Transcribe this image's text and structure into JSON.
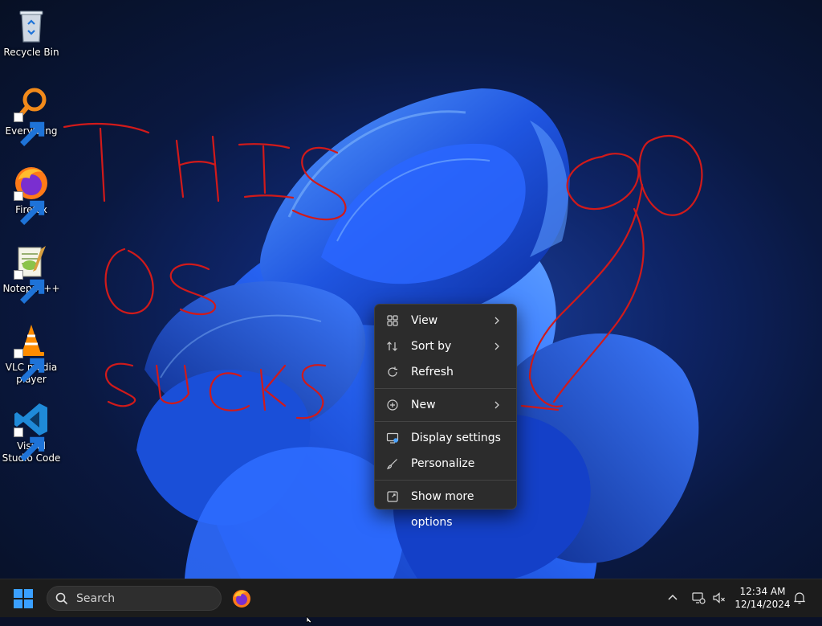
{
  "desktop": {
    "icons": [
      {
        "label": "Recycle Bin",
        "icon": "recycle-bin-icon",
        "shortcut": false
      },
      {
        "label": "Everything",
        "icon": "magnifier-icon",
        "shortcut": true
      },
      {
        "label": "Firefox",
        "icon": "firefox-icon",
        "shortcut": true
      },
      {
        "label": "Notepad++",
        "icon": "notepadpp-icon",
        "shortcut": true
      },
      {
        "label": "VLC media player",
        "icon": "vlc-cone-icon",
        "shortcut": true
      },
      {
        "label": "Visual Studio Code",
        "icon": "vscode-icon",
        "shortcut": true
      }
    ],
    "scribble_text": "THIS OS SUCKS",
    "scribble_color": "#d11a1a"
  },
  "context_menu": {
    "items": [
      {
        "label": "View",
        "icon": "grid-icon",
        "submenu": true
      },
      {
        "label": "Sort by",
        "icon": "sort-icon",
        "submenu": true
      },
      {
        "label": "Refresh",
        "icon": "refresh-icon",
        "submenu": false
      },
      {
        "label": "New",
        "icon": "plus-circle-icon",
        "submenu": true
      },
      {
        "label": "Display settings",
        "icon": "display-icon",
        "submenu": false
      },
      {
        "label": "Personalize",
        "icon": "brush-icon",
        "submenu": false
      },
      {
        "label": "Show more options",
        "icon": "expand-icon",
        "submenu": false
      }
    ]
  },
  "taskbar": {
    "search_placeholder": "Search",
    "clock_time": "12:34 AM",
    "clock_date": "12/14/2024",
    "accent": "#1e90ff"
  }
}
